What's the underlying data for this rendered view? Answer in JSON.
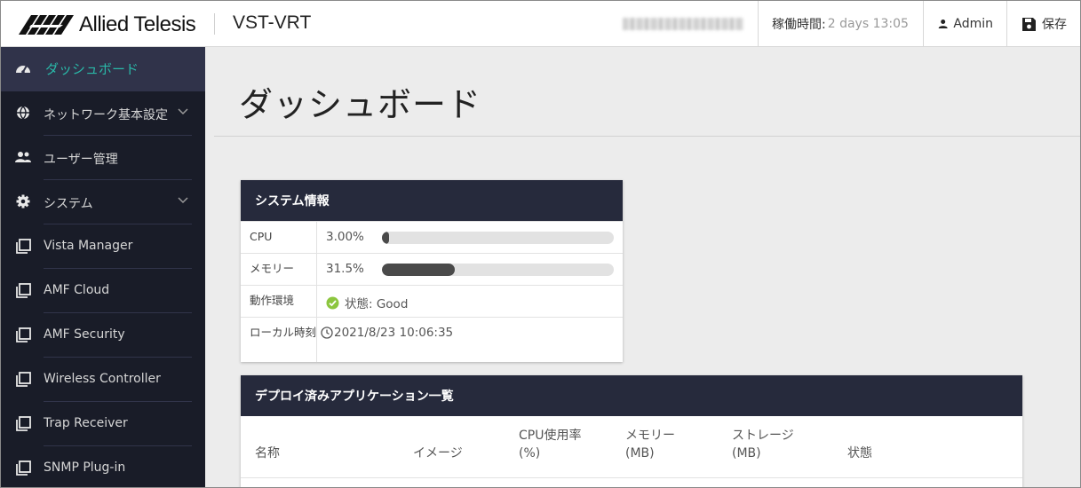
{
  "header": {
    "logo_text": "Allied Telesis",
    "device_name": "VST-VRT",
    "uptime_label": "稼働時間:",
    "uptime_value": "2 days 13:05",
    "admin_label": "Admin",
    "save_label": "保存",
    "accent": "#2ab8a8",
    "header_bg": "#ffffff"
  },
  "sidebar": {
    "bg": "#191c28",
    "items": [
      {
        "label": "ダッシュボード",
        "icon": "speedometer-icon",
        "active": true
      },
      {
        "label": "ネットワーク基本設定",
        "icon": "globe-icon",
        "chevron": true
      },
      {
        "label": "ユーザー管理",
        "icon": "users-icon"
      },
      {
        "label": "システム",
        "icon": "gear-icon",
        "chevron": true
      },
      {
        "label": "Vista Manager",
        "icon": "window-stack-icon"
      },
      {
        "label": "AMF Cloud",
        "icon": "window-stack-icon"
      },
      {
        "label": "AMF Security",
        "icon": "window-stack-icon"
      },
      {
        "label": "Wireless Controller",
        "icon": "window-stack-icon"
      },
      {
        "label": "Trap Receiver",
        "icon": "window-stack-icon"
      },
      {
        "label": "SNMP Plug-in",
        "icon": "window-stack-icon"
      }
    ]
  },
  "main": {
    "page_title": "ダッシュボード",
    "system_info": {
      "title": "システム情報",
      "cpu_label": "CPU",
      "cpu_value": "3.00%",
      "cpu_fraction": 0.03,
      "memory_label": "メモリー",
      "memory_value": "31.5%",
      "memory_fraction": 0.315,
      "env_label": "動作環境",
      "env_status": "状態: Good",
      "env_color": "#8cc63f",
      "time_label": "ローカル時刻",
      "time_value": "2021/8/23 10:06:35"
    },
    "deployed_apps": {
      "title": "デプロイ済みアプリケーション一覧",
      "columns": [
        "名称",
        "イメージ",
        "CPU使用率\n(%)",
        "メモリー\n(MB)",
        "ストレージ\n(MB)",
        "状態"
      ]
    }
  }
}
